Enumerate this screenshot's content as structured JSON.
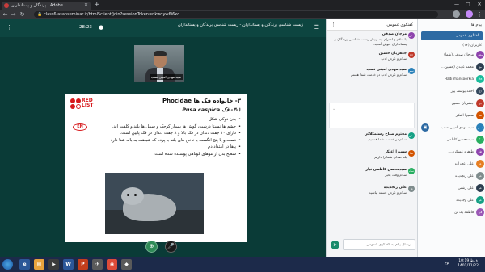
{
  "browser": {
    "tab_title": "پرندگان و پستانداران | Adobe",
    "url": "class6.asanseminar.ir/html5client/join?sessionToken=nkwdyw6i6xq…"
  },
  "meeting": {
    "title": "زیست شناسی پرندگان و پستانداران - زیست شناسی پرندگان و پستانداران",
    "time": "28:23",
    "presenter_name": "سید مهدی امینی نسب"
  },
  "slide": {
    "heading": "۳- خانواده فک ها Phocidae",
    "subheading": "۳-۱- فک Pusa caspica",
    "red_list": "RED LIST",
    "status_badge": "EN",
    "bullets": [
      "بدن دوکی شکل",
      "چشم ها نسبتا درشت، گوش ها بسیار کوچک و سبیل ها بلند و کلفت اند.",
      "دارای ۱۰ جفت دندان در فک بالا و ۸ جفت دندان در فک پایین است.",
      "دست و پا پنج انگشت با ناخن های بلند با پرده که شباهت به باله شنا دارد",
      "پاها در امتداد دم",
      "سطح بدن از موهای کوتاهی پوشیده شده است."
    ]
  },
  "chat": {
    "title": "گفتگوی عمومی",
    "messages": [
      {
        "initials": "مص",
        "color": "#8e44ad",
        "name": "مرجان صدقی",
        "text": "با سلام و احترام، به وبینار زیست شناسی پرندگان و پستانداران خوش آمدید."
      },
      {
        "initials": "جح",
        "color": "#c0392b",
        "name": "جعفریان حسین",
        "text": "سلام و عرض ادب"
      },
      {
        "initials": "سم",
        "color": "#2980b9",
        "name": "سید مهدی امینی نسب",
        "text": "سلام و عرض ادب در خدمت شما هستم"
      },
      {
        "initials": "مص",
        "color": "#16a085",
        "name": "محتوم صباح رستمکلائی",
        "text": "سلام در خدمت شما هستیم"
      },
      {
        "initials": "سا",
        "color": "#d35400",
        "name": "سمیرا اعتکر",
        "text": "بله صدای شما را داریم"
      },
      {
        "initials": "سک",
        "color": "#27ae60",
        "name": "سیدمحسن کاظمی نیار",
        "text": "سلام وقت بخیر"
      },
      {
        "initials": "عر",
        "color": "#7f8c8d",
        "name": "علی رنجدیده",
        "text": "سلام و عرض خسته نباشید"
      }
    ],
    "input_placeholder": "ارسال پیام به گفتگوی عمومی"
  },
  "users": {
    "header": "پیام ها",
    "public_chat": "گفتگوی عمومی",
    "count_label": "کاربران (۱۲)",
    "list": [
      {
        "initials": "مص",
        "color": "#8e44ad",
        "name": "مرجان صدقی (شما)"
      },
      {
        "initials": "مع",
        "color": "#2c3e50",
        "name": "محمد عابدی (حسین..."
      },
      {
        "initials": "Ha",
        "color": "#1abc9c",
        "name": "Hadi mansoorkia"
      },
      {
        "initials": "اح",
        "color": "#34495e",
        "name": "احمد یوسف پور"
      },
      {
        "initials": "جح",
        "color": "#c0392b",
        "name": "جعفریان حسین"
      },
      {
        "initials": "سا",
        "color": "#d35400",
        "name": "سمیرا اعتکر"
      },
      {
        "initials": "سم",
        "color": "#2980b9",
        "name": "سید مهدی امینی نسب"
      },
      {
        "initials": "سک",
        "color": "#27ae60",
        "name": "سیدمحسن کاظمی..."
      },
      {
        "initials": "طع",
        "color": "#8e44ad",
        "name": "طاهره عسکری..."
      },
      {
        "initials": "عا",
        "color": "#e67e22",
        "name": "علی اعجزاده"
      },
      {
        "initials": "عر",
        "color": "#7f8c8d",
        "name": "علی رنجدیده"
      },
      {
        "initials": "عر",
        "color": "#2c3e50",
        "name": "علی رشتی"
      },
      {
        "initials": "عو",
        "color": "#16a085",
        "name": "علی وجدیده"
      },
      {
        "initials": "فی",
        "color": "#9b59b6",
        "name": "فاطمه یک تن"
      }
    ]
  },
  "taskbar": {
    "lang": "FA",
    "time": "10:19 ق.ظ",
    "date": "1401/11/22"
  }
}
